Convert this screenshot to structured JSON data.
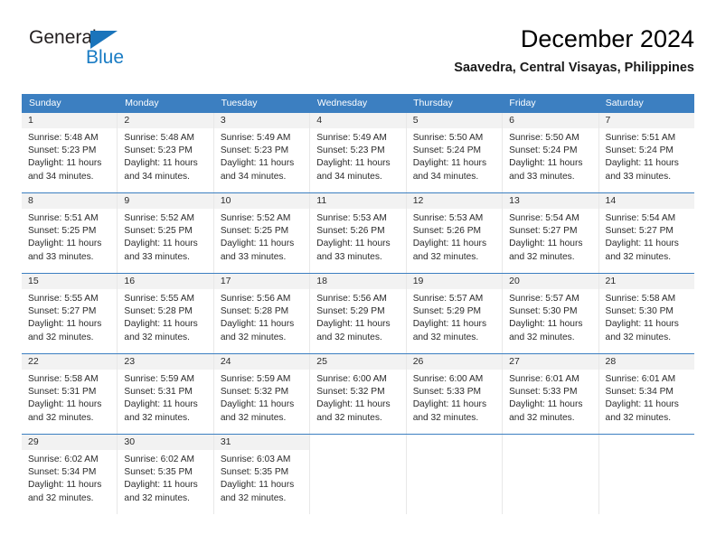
{
  "logo": {
    "word_top": "General",
    "word_bottom": "Blue",
    "triangle_color": "#1a74bb",
    "top_color": "#231f20",
    "bottom_color": "#1a7cc4"
  },
  "header": {
    "title": "December 2024",
    "subtitle": "Saavedra, Central Visayas, Philippines"
  },
  "theme": {
    "header_bg": "#3c7fc1",
    "header_text": "#ffffff",
    "day_head_bg": "#f2f2f2",
    "cell_border": "#e8e8e8",
    "text": "#2b2b2b"
  },
  "weekdays": [
    "Sunday",
    "Monday",
    "Tuesday",
    "Wednesday",
    "Thursday",
    "Friday",
    "Saturday"
  ],
  "weeks": [
    [
      {
        "day": "1",
        "sunrise": "Sunrise: 5:48 AM",
        "sunset": "Sunset: 5:23 PM",
        "daylight1": "Daylight: 11 hours",
        "daylight2": "and 34 minutes."
      },
      {
        "day": "2",
        "sunrise": "Sunrise: 5:48 AM",
        "sunset": "Sunset: 5:23 PM",
        "daylight1": "Daylight: 11 hours",
        "daylight2": "and 34 minutes."
      },
      {
        "day": "3",
        "sunrise": "Sunrise: 5:49 AM",
        "sunset": "Sunset: 5:23 PM",
        "daylight1": "Daylight: 11 hours",
        "daylight2": "and 34 minutes."
      },
      {
        "day": "4",
        "sunrise": "Sunrise: 5:49 AM",
        "sunset": "Sunset: 5:23 PM",
        "daylight1": "Daylight: 11 hours",
        "daylight2": "and 34 minutes."
      },
      {
        "day": "5",
        "sunrise": "Sunrise: 5:50 AM",
        "sunset": "Sunset: 5:24 PM",
        "daylight1": "Daylight: 11 hours",
        "daylight2": "and 34 minutes."
      },
      {
        "day": "6",
        "sunrise": "Sunrise: 5:50 AM",
        "sunset": "Sunset: 5:24 PM",
        "daylight1": "Daylight: 11 hours",
        "daylight2": "and 33 minutes."
      },
      {
        "day": "7",
        "sunrise": "Sunrise: 5:51 AM",
        "sunset": "Sunset: 5:24 PM",
        "daylight1": "Daylight: 11 hours",
        "daylight2": "and 33 minutes."
      }
    ],
    [
      {
        "day": "8",
        "sunrise": "Sunrise: 5:51 AM",
        "sunset": "Sunset: 5:25 PM",
        "daylight1": "Daylight: 11 hours",
        "daylight2": "and 33 minutes."
      },
      {
        "day": "9",
        "sunrise": "Sunrise: 5:52 AM",
        "sunset": "Sunset: 5:25 PM",
        "daylight1": "Daylight: 11 hours",
        "daylight2": "and 33 minutes."
      },
      {
        "day": "10",
        "sunrise": "Sunrise: 5:52 AM",
        "sunset": "Sunset: 5:25 PM",
        "daylight1": "Daylight: 11 hours",
        "daylight2": "and 33 minutes."
      },
      {
        "day": "11",
        "sunrise": "Sunrise: 5:53 AM",
        "sunset": "Sunset: 5:26 PM",
        "daylight1": "Daylight: 11 hours",
        "daylight2": "and 33 minutes."
      },
      {
        "day": "12",
        "sunrise": "Sunrise: 5:53 AM",
        "sunset": "Sunset: 5:26 PM",
        "daylight1": "Daylight: 11 hours",
        "daylight2": "and 32 minutes."
      },
      {
        "day": "13",
        "sunrise": "Sunrise: 5:54 AM",
        "sunset": "Sunset: 5:27 PM",
        "daylight1": "Daylight: 11 hours",
        "daylight2": "and 32 minutes."
      },
      {
        "day": "14",
        "sunrise": "Sunrise: 5:54 AM",
        "sunset": "Sunset: 5:27 PM",
        "daylight1": "Daylight: 11 hours",
        "daylight2": "and 32 minutes."
      }
    ],
    [
      {
        "day": "15",
        "sunrise": "Sunrise: 5:55 AM",
        "sunset": "Sunset: 5:27 PM",
        "daylight1": "Daylight: 11 hours",
        "daylight2": "and 32 minutes."
      },
      {
        "day": "16",
        "sunrise": "Sunrise: 5:55 AM",
        "sunset": "Sunset: 5:28 PM",
        "daylight1": "Daylight: 11 hours",
        "daylight2": "and 32 minutes."
      },
      {
        "day": "17",
        "sunrise": "Sunrise: 5:56 AM",
        "sunset": "Sunset: 5:28 PM",
        "daylight1": "Daylight: 11 hours",
        "daylight2": "and 32 minutes."
      },
      {
        "day": "18",
        "sunrise": "Sunrise: 5:56 AM",
        "sunset": "Sunset: 5:29 PM",
        "daylight1": "Daylight: 11 hours",
        "daylight2": "and 32 minutes."
      },
      {
        "day": "19",
        "sunrise": "Sunrise: 5:57 AM",
        "sunset": "Sunset: 5:29 PM",
        "daylight1": "Daylight: 11 hours",
        "daylight2": "and 32 minutes."
      },
      {
        "day": "20",
        "sunrise": "Sunrise: 5:57 AM",
        "sunset": "Sunset: 5:30 PM",
        "daylight1": "Daylight: 11 hours",
        "daylight2": "and 32 minutes."
      },
      {
        "day": "21",
        "sunrise": "Sunrise: 5:58 AM",
        "sunset": "Sunset: 5:30 PM",
        "daylight1": "Daylight: 11 hours",
        "daylight2": "and 32 minutes."
      }
    ],
    [
      {
        "day": "22",
        "sunrise": "Sunrise: 5:58 AM",
        "sunset": "Sunset: 5:31 PM",
        "daylight1": "Daylight: 11 hours",
        "daylight2": "and 32 minutes."
      },
      {
        "day": "23",
        "sunrise": "Sunrise: 5:59 AM",
        "sunset": "Sunset: 5:31 PM",
        "daylight1": "Daylight: 11 hours",
        "daylight2": "and 32 minutes."
      },
      {
        "day": "24",
        "sunrise": "Sunrise: 5:59 AM",
        "sunset": "Sunset: 5:32 PM",
        "daylight1": "Daylight: 11 hours",
        "daylight2": "and 32 minutes."
      },
      {
        "day": "25",
        "sunrise": "Sunrise: 6:00 AM",
        "sunset": "Sunset: 5:32 PM",
        "daylight1": "Daylight: 11 hours",
        "daylight2": "and 32 minutes."
      },
      {
        "day": "26",
        "sunrise": "Sunrise: 6:00 AM",
        "sunset": "Sunset: 5:33 PM",
        "daylight1": "Daylight: 11 hours",
        "daylight2": "and 32 minutes."
      },
      {
        "day": "27",
        "sunrise": "Sunrise: 6:01 AM",
        "sunset": "Sunset: 5:33 PM",
        "daylight1": "Daylight: 11 hours",
        "daylight2": "and 32 minutes."
      },
      {
        "day": "28",
        "sunrise": "Sunrise: 6:01 AM",
        "sunset": "Sunset: 5:34 PM",
        "daylight1": "Daylight: 11 hours",
        "daylight2": "and 32 minutes."
      }
    ],
    [
      {
        "day": "29",
        "sunrise": "Sunrise: 6:02 AM",
        "sunset": "Sunset: 5:34 PM",
        "daylight1": "Daylight: 11 hours",
        "daylight2": "and 32 minutes."
      },
      {
        "day": "30",
        "sunrise": "Sunrise: 6:02 AM",
        "sunset": "Sunset: 5:35 PM",
        "daylight1": "Daylight: 11 hours",
        "daylight2": "and 32 minutes."
      },
      {
        "day": "31",
        "sunrise": "Sunrise: 6:03 AM",
        "sunset": "Sunset: 5:35 PM",
        "daylight1": "Daylight: 11 hours",
        "daylight2": "and 32 minutes."
      },
      {
        "day": "",
        "sunrise": "",
        "sunset": "",
        "daylight1": "",
        "daylight2": ""
      },
      {
        "day": "",
        "sunrise": "",
        "sunset": "",
        "daylight1": "",
        "daylight2": ""
      },
      {
        "day": "",
        "sunrise": "",
        "sunset": "",
        "daylight1": "",
        "daylight2": ""
      },
      {
        "day": "",
        "sunrise": "",
        "sunset": "",
        "daylight1": "",
        "daylight2": ""
      }
    ]
  ]
}
